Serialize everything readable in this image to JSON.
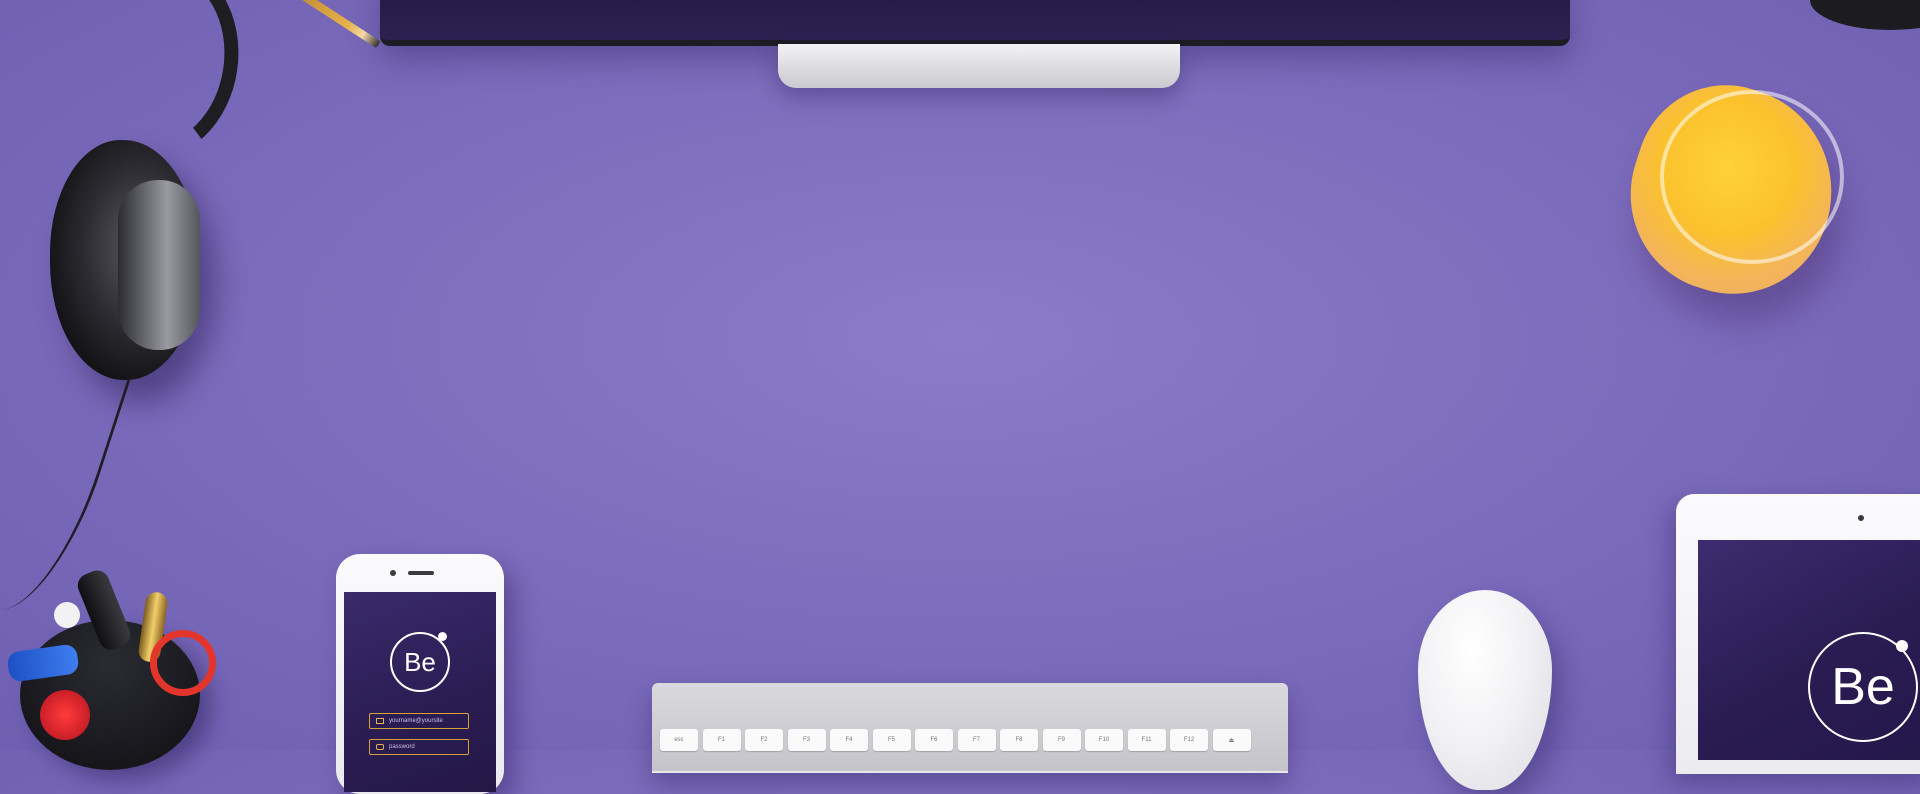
{
  "scene": {
    "background_color": "#7f70c0"
  },
  "phone": {
    "logo_text": "Be",
    "email_placeholder": "yourname@yoursite",
    "password_placeholder": "password"
  },
  "tablet": {
    "logo_text": "Be"
  },
  "keyboard": {
    "keys": [
      "esc",
      "F1",
      "F2",
      "F3",
      "F4",
      "F5",
      "F6",
      "F7",
      "F8",
      "F9",
      "F10",
      "F11",
      "F12",
      "⏏"
    ]
  }
}
